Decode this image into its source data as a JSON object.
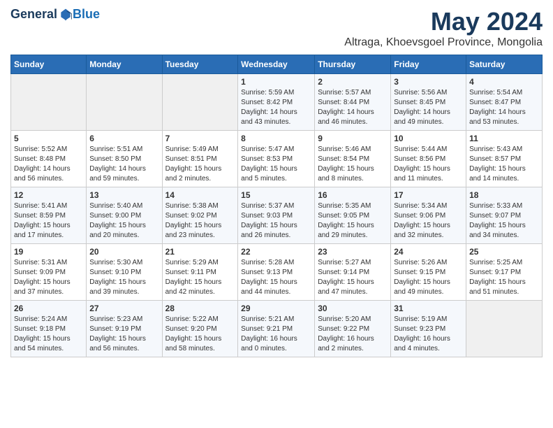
{
  "header": {
    "logo_general": "General",
    "logo_blue": "Blue",
    "month_title": "May 2024",
    "location": "Altraga, Khoevsgoel Province, Mongolia"
  },
  "days_of_week": [
    "Sunday",
    "Monday",
    "Tuesday",
    "Wednesday",
    "Thursday",
    "Friday",
    "Saturday"
  ],
  "weeks": [
    [
      {
        "day": "",
        "info": ""
      },
      {
        "day": "",
        "info": ""
      },
      {
        "day": "",
        "info": ""
      },
      {
        "day": "1",
        "info": "Sunrise: 5:59 AM\nSunset: 8:42 PM\nDaylight: 14 hours\nand 43 minutes."
      },
      {
        "day": "2",
        "info": "Sunrise: 5:57 AM\nSunset: 8:44 PM\nDaylight: 14 hours\nand 46 minutes."
      },
      {
        "day": "3",
        "info": "Sunrise: 5:56 AM\nSunset: 8:45 PM\nDaylight: 14 hours\nand 49 minutes."
      },
      {
        "day": "4",
        "info": "Sunrise: 5:54 AM\nSunset: 8:47 PM\nDaylight: 14 hours\nand 53 minutes."
      }
    ],
    [
      {
        "day": "5",
        "info": "Sunrise: 5:52 AM\nSunset: 8:48 PM\nDaylight: 14 hours\nand 56 minutes."
      },
      {
        "day": "6",
        "info": "Sunrise: 5:51 AM\nSunset: 8:50 PM\nDaylight: 14 hours\nand 59 minutes."
      },
      {
        "day": "7",
        "info": "Sunrise: 5:49 AM\nSunset: 8:51 PM\nDaylight: 15 hours\nand 2 minutes."
      },
      {
        "day": "8",
        "info": "Sunrise: 5:47 AM\nSunset: 8:53 PM\nDaylight: 15 hours\nand 5 minutes."
      },
      {
        "day": "9",
        "info": "Sunrise: 5:46 AM\nSunset: 8:54 PM\nDaylight: 15 hours\nand 8 minutes."
      },
      {
        "day": "10",
        "info": "Sunrise: 5:44 AM\nSunset: 8:56 PM\nDaylight: 15 hours\nand 11 minutes."
      },
      {
        "day": "11",
        "info": "Sunrise: 5:43 AM\nSunset: 8:57 PM\nDaylight: 15 hours\nand 14 minutes."
      }
    ],
    [
      {
        "day": "12",
        "info": "Sunrise: 5:41 AM\nSunset: 8:59 PM\nDaylight: 15 hours\nand 17 minutes."
      },
      {
        "day": "13",
        "info": "Sunrise: 5:40 AM\nSunset: 9:00 PM\nDaylight: 15 hours\nand 20 minutes."
      },
      {
        "day": "14",
        "info": "Sunrise: 5:38 AM\nSunset: 9:02 PM\nDaylight: 15 hours\nand 23 minutes."
      },
      {
        "day": "15",
        "info": "Sunrise: 5:37 AM\nSunset: 9:03 PM\nDaylight: 15 hours\nand 26 minutes."
      },
      {
        "day": "16",
        "info": "Sunrise: 5:35 AM\nSunset: 9:05 PM\nDaylight: 15 hours\nand 29 minutes."
      },
      {
        "day": "17",
        "info": "Sunrise: 5:34 AM\nSunset: 9:06 PM\nDaylight: 15 hours\nand 32 minutes."
      },
      {
        "day": "18",
        "info": "Sunrise: 5:33 AM\nSunset: 9:07 PM\nDaylight: 15 hours\nand 34 minutes."
      }
    ],
    [
      {
        "day": "19",
        "info": "Sunrise: 5:31 AM\nSunset: 9:09 PM\nDaylight: 15 hours\nand 37 minutes."
      },
      {
        "day": "20",
        "info": "Sunrise: 5:30 AM\nSunset: 9:10 PM\nDaylight: 15 hours\nand 39 minutes."
      },
      {
        "day": "21",
        "info": "Sunrise: 5:29 AM\nSunset: 9:11 PM\nDaylight: 15 hours\nand 42 minutes."
      },
      {
        "day": "22",
        "info": "Sunrise: 5:28 AM\nSunset: 9:13 PM\nDaylight: 15 hours\nand 44 minutes."
      },
      {
        "day": "23",
        "info": "Sunrise: 5:27 AM\nSunset: 9:14 PM\nDaylight: 15 hours\nand 47 minutes."
      },
      {
        "day": "24",
        "info": "Sunrise: 5:26 AM\nSunset: 9:15 PM\nDaylight: 15 hours\nand 49 minutes."
      },
      {
        "day": "25",
        "info": "Sunrise: 5:25 AM\nSunset: 9:17 PM\nDaylight: 15 hours\nand 51 minutes."
      }
    ],
    [
      {
        "day": "26",
        "info": "Sunrise: 5:24 AM\nSunset: 9:18 PM\nDaylight: 15 hours\nand 54 minutes."
      },
      {
        "day": "27",
        "info": "Sunrise: 5:23 AM\nSunset: 9:19 PM\nDaylight: 15 hours\nand 56 minutes."
      },
      {
        "day": "28",
        "info": "Sunrise: 5:22 AM\nSunset: 9:20 PM\nDaylight: 15 hours\nand 58 minutes."
      },
      {
        "day": "29",
        "info": "Sunrise: 5:21 AM\nSunset: 9:21 PM\nDaylight: 16 hours\nand 0 minutes."
      },
      {
        "day": "30",
        "info": "Sunrise: 5:20 AM\nSunset: 9:22 PM\nDaylight: 16 hours\nand 2 minutes."
      },
      {
        "day": "31",
        "info": "Sunrise: 5:19 AM\nSunset: 9:23 PM\nDaylight: 16 hours\nand 4 minutes."
      },
      {
        "day": "",
        "info": ""
      }
    ]
  ]
}
